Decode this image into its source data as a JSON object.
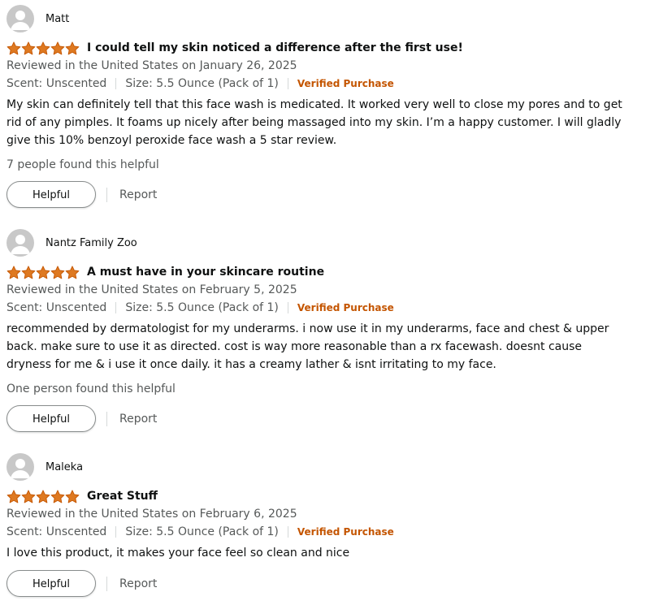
{
  "colors": {
    "star": "#de7921",
    "star_outline": "#c45500",
    "verified": "#c45500",
    "muted_text": "#565959",
    "text": "#0f1111",
    "avatar_bg": "#c8c8c8"
  },
  "icons": {
    "avatar": "default-user-avatar-icon",
    "star": "star-filled-icon"
  },
  "reviews": [
    {
      "author": "Matt",
      "rating": 5,
      "title": "I could tell my skin noticed a difference after the first use!",
      "date": "Reviewed in the United States on January 26, 2025",
      "scent": "Scent: Unscented",
      "size": "Size: 5.5 Ounce (Pack of 1)",
      "verified": "Verified Purchase",
      "body": "My skin can definitely tell that this face wash is medicated. It worked very well to close my pores and to get rid of any pimples. It foams up nicely after being massaged into my skin. I’m a happy customer. I will gladly give this 10% benzoyl peroxide face wash a 5 star review.",
      "helpful_count": "7 people found this helpful",
      "helpful_label": "Helpful",
      "report_label": "Report"
    },
    {
      "author": "Nantz Family Zoo",
      "rating": 5,
      "title": "A must have in your skincare routine",
      "date": "Reviewed in the United States on February 5, 2025",
      "scent": "Scent: Unscented",
      "size": "Size: 5.5 Ounce (Pack of 1)",
      "verified": "Verified Purchase",
      "body": "recommended by dermatologist for my underarms. i now use it in my underarms, face and chest & upper back. make sure to use it as directed. cost is way more reasonable than a rx facewash. doesnt cause dryness for me & i use it once daily. it has a creamy lather & isnt irritating to my face.",
      "helpful_count": "One person found this helpful",
      "helpful_label": "Helpful",
      "report_label": "Report"
    },
    {
      "author": "Maleka",
      "rating": 5,
      "title": "Great Stuff",
      "date": "Reviewed in the United States on February 6, 2025",
      "scent": "Scent: Unscented",
      "size": "Size: 5.5 Ounce (Pack of 1)",
      "verified": "Verified Purchase",
      "body": "I love this product, it makes your face feel so clean and nice",
      "helpful_count": "",
      "helpful_label": "Helpful",
      "report_label": "Report"
    }
  ]
}
